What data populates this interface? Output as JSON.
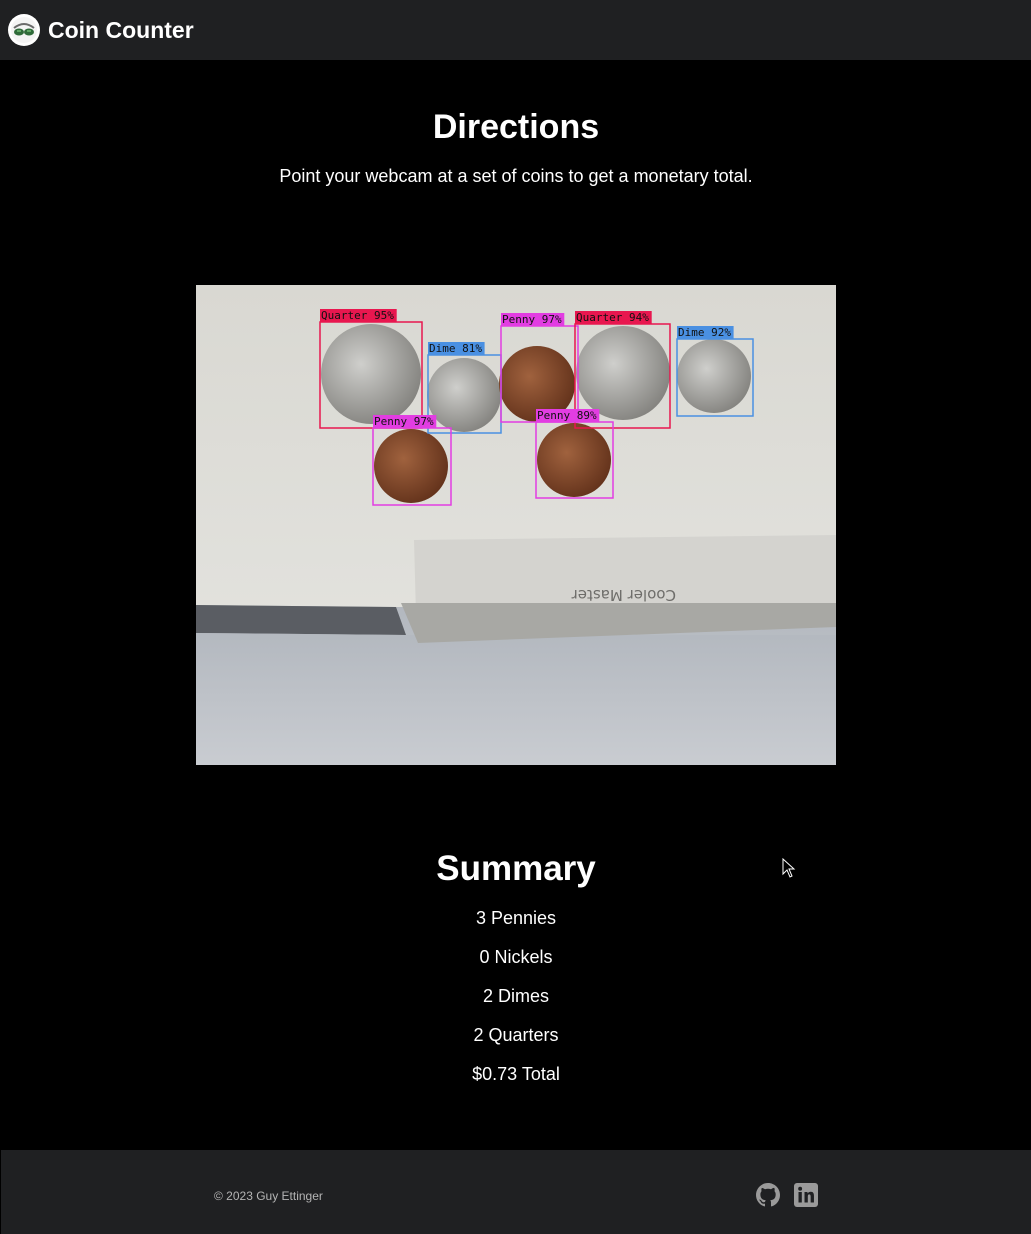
{
  "nav": {
    "brand": "Coin Counter",
    "logo_icon": "glasses-avatar-icon"
  },
  "directions": {
    "title": "Directions",
    "text": "Point your webcam at a set of coins to get a monetary total."
  },
  "webcam": {
    "detections": [
      {
        "label": "Quarter 95%",
        "type": "quarter"
      },
      {
        "label": "Dime 81%",
        "type": "dime"
      },
      {
        "label": "Penny 97%",
        "type": "penny"
      },
      {
        "label": "Quarter 94%",
        "type": "quarter"
      },
      {
        "label": "Dime 92%",
        "type": "dime"
      },
      {
        "label": "Penny 97%",
        "type": "penny"
      },
      {
        "label": "Penny 89%",
        "type": "penny"
      }
    ],
    "box_colors": {
      "quarter": "#e8174f",
      "dime": "#4a90e2",
      "penny": "#e23de2"
    },
    "box_text": "Cooler Master"
  },
  "summary": {
    "title": "Summary",
    "items": [
      "3 Pennies",
      "0 Nickels",
      "2 Dimes",
      "2 Quarters",
      "$0.73 Total"
    ]
  },
  "footer": {
    "copyright": "© 2023 Guy Ettinger",
    "icons": [
      "github-icon",
      "linkedin-icon"
    ]
  }
}
